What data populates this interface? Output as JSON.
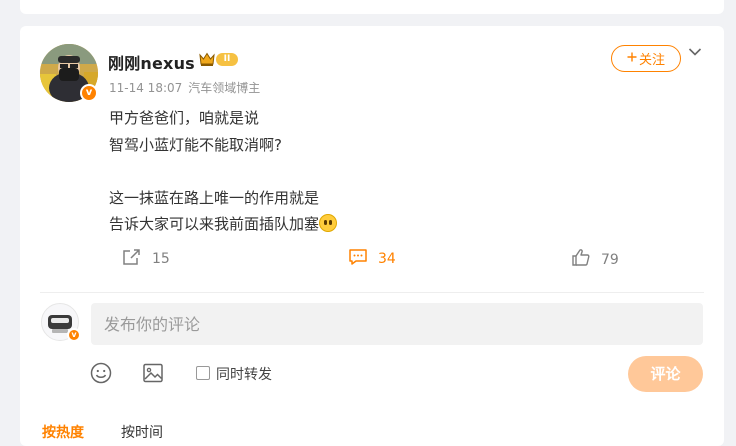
{
  "post": {
    "username": "刚刚nexus",
    "level": "II",
    "verify_mark": "v",
    "timestamp": "11-14 18:07",
    "source": "汽车领域博主",
    "follow_label": "关注",
    "lines": [
      "甲方爸爸们，咱就是说",
      "智驾小蓝灯能不能取消啊?",
      "",
      "这一抹蓝在路上唯一的作用就是",
      "告诉大家可以来我前面插队加塞"
    ],
    "emoji_name": "smile-emoji"
  },
  "actions": {
    "repost_count": "15",
    "comment_count": "34",
    "like_count": "79"
  },
  "composer": {
    "placeholder": "发布你的评论",
    "repost_label": "同时转发",
    "submit_label": "评论"
  },
  "sort": {
    "hot_label": "按热度",
    "time_label": "按时间"
  },
  "colors": {
    "accent": "#ff8200",
    "submit_disabled": "#ffc899",
    "background": "#f1f2f5"
  },
  "icons": [
    "crown-icon",
    "chevron-down-icon",
    "repost-icon",
    "comment-icon",
    "like-icon",
    "emoji-icon",
    "image-icon",
    "plus-icon"
  ]
}
